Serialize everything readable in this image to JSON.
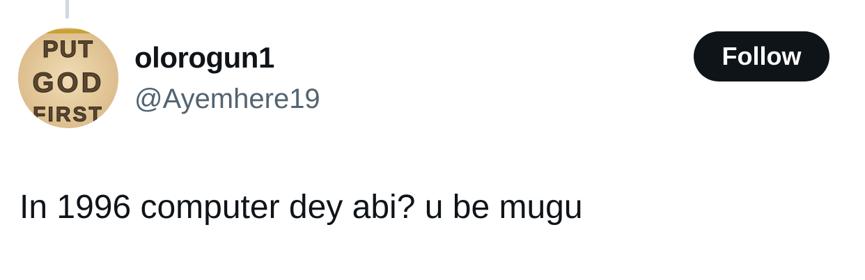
{
  "tweet": {
    "author": {
      "display_name": "olorogun1",
      "handle": "@Ayemhere19",
      "avatar": {
        "description_text": [
          "PUT",
          "GOD",
          "FIRST"
        ],
        "background_color": "#ead1a6"
      }
    },
    "follow_label": "Follow",
    "text": "In 1996 computer dey abi? u be mugu"
  },
  "colors": {
    "primary_text": "#0f1419",
    "secondary_text": "#536471",
    "button_bg": "#0f1419",
    "button_text": "#ffffff",
    "thread_line": "#cfd9de"
  }
}
